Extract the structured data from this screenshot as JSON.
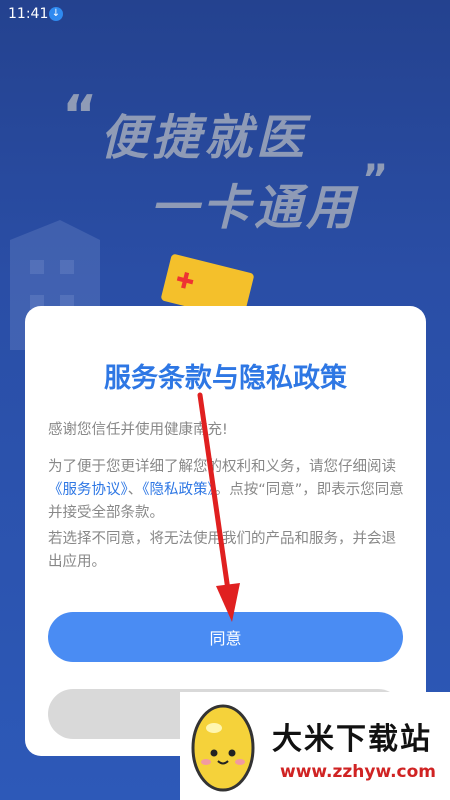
{
  "status_bar": {
    "time": "11:41",
    "download_icon": "download-icon"
  },
  "hero": {
    "quote_open": "“",
    "line1": "便捷就医",
    "line2": "一卡通用",
    "quote_close": "”"
  },
  "dialog": {
    "title": "服务条款与隐私政策",
    "p1": "感谢您信任并使用健康南充!",
    "p2_before": "为了便于您更详细了解您的权利和义务，请您仔细阅读",
    "p2_link1": "《服务协议》",
    "p2_sep": "、",
    "p2_link2": "《隐私政策》",
    "p2_after": "。点按“同意”，即表示您同意并接受全部条款。",
    "p3": "若选择不同意，将无法使用我们的产品和服务，并会退出应用。",
    "agree_label": "同意",
    "disagree_label": ""
  },
  "watermark": {
    "title": "大米下载站",
    "url": "www.zzhyw.com"
  },
  "colors": {
    "accent": "#2e77e4",
    "agree_button": "#4a8cf3",
    "arrow": "#e02020"
  }
}
